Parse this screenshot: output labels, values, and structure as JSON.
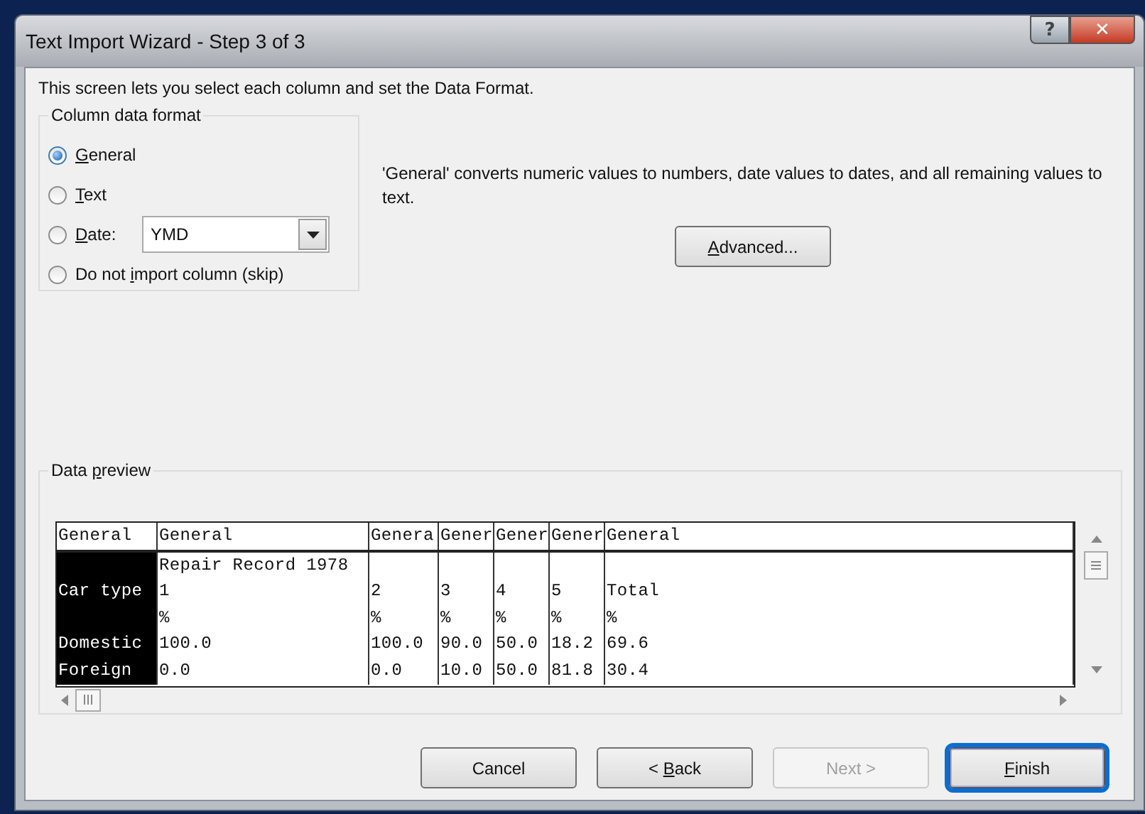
{
  "window": {
    "title": "Text Import Wizard - Step 3 of 3",
    "help_button": "?",
    "close_button": "✕"
  },
  "intro": "This screen lets you select each column and set the Data Format.",
  "column_data_format": {
    "title": "Column data format",
    "options": [
      {
        "access_key": "G",
        "label_after": "eneral",
        "selected": true,
        "kind": "plain"
      },
      {
        "access_key": "T",
        "label_after": "ext",
        "selected": false,
        "kind": "plain"
      },
      {
        "access_key": "D",
        "label_after": "ate:",
        "selected": false,
        "kind": "date",
        "value": "YMD"
      },
      {
        "label_before": "Do not ",
        "access_key": "i",
        "label_after": "mport column (skip)",
        "selected": false,
        "kind": "plain"
      }
    ]
  },
  "description": "'General' converts numeric values to numbers, date values to dates, and all remaining values to text.",
  "advanced_button": {
    "access_key": "A",
    "label_after": "dvanced..."
  },
  "data_preview": {
    "title_before": "Data ",
    "access_key": "p",
    "title_after": "review",
    "columns": [
      {
        "header": "General",
        "selected": true
      },
      {
        "header": "General",
        "selected": false
      },
      {
        "header": "Genera",
        "selected": false
      },
      {
        "header": "Gener",
        "selected": false
      },
      {
        "header": "Gener",
        "selected": false
      },
      {
        "header": "Gener",
        "selected": false
      },
      {
        "header": "General",
        "selected": false
      }
    ],
    "rows": [
      [
        "",
        "Repair Record 1978",
        "",
        "",
        "",
        "",
        ""
      ],
      [
        "Car type",
        "1",
        "2",
        "3",
        "4",
        "5",
        "Total"
      ],
      [
        "",
        "%",
        "%",
        "%",
        "%",
        "%",
        "%"
      ],
      [
        "Domestic",
        "100.0",
        "100.0",
        "90.0",
        "50.0",
        "18.2",
        "69.6"
      ],
      [
        "Foreign",
        "0.0",
        "0.0",
        "10.0",
        "50.0",
        "81.8",
        "30.4"
      ]
    ]
  },
  "buttons": [
    {
      "label_before": "Cancel",
      "disabled": false,
      "default": false
    },
    {
      "label_before": "< ",
      "access_key": "B",
      "label_after": "ack",
      "disabled": false,
      "default": false
    },
    {
      "label_before": "Next >",
      "disabled": true,
      "default": false
    },
    {
      "access_key": "F",
      "label_after": "inish",
      "disabled": false,
      "default": true
    }
  ]
}
